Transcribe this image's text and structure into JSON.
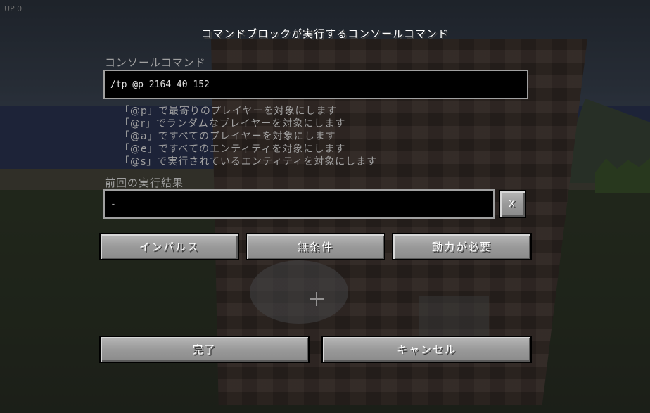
{
  "hud": {
    "version": "UP 0"
  },
  "gui": {
    "title": "コマンドブロックが実行するコンソールコマンド",
    "console_label": "コンソールコマンド",
    "command_value": "/tp @p 2164 40 152",
    "hints": [
      "「@p」で最寄りのプレイヤーを対象にします",
      "「@r」でランダムなプレイヤーを対象にします",
      "「@a」ですべてのプレイヤーを対象にします",
      "「@e」ですべてのエンティティを対象にします",
      "「@s」で実行されているエンティティを対象にします"
    ],
    "previous_output_label": "前回の実行結果",
    "previous_output_value": "-",
    "clear_output_button": "X",
    "mode_button": "インパルス",
    "condition_button": "無条件",
    "redstone_button": "動力が必要",
    "done_button": "完了",
    "cancel_button": "キャンセル"
  }
}
